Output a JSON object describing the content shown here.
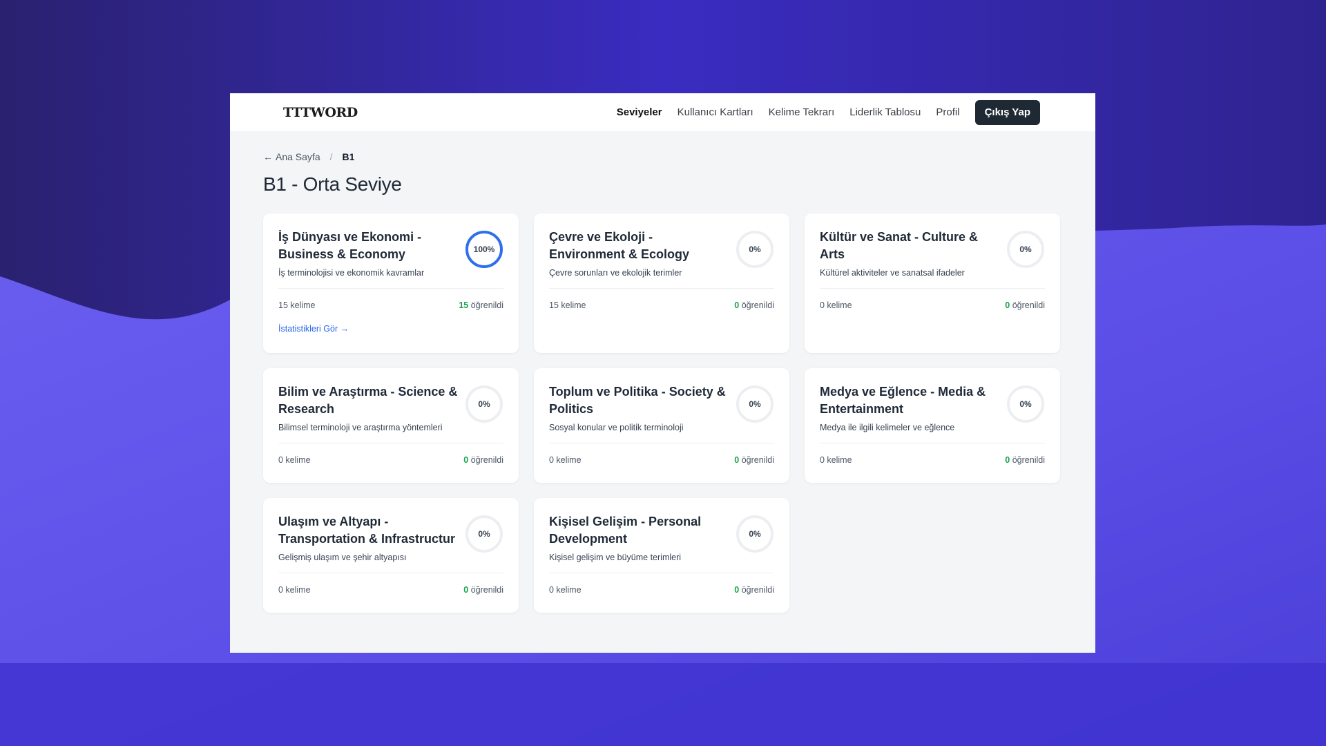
{
  "brand": {
    "logo": "TTTWORD"
  },
  "nav": {
    "items": [
      {
        "label": "Seviyeler",
        "active": true
      },
      {
        "label": "Kullanıcı Kartları",
        "active": false
      },
      {
        "label": "Kelime Tekrarı",
        "active": false
      },
      {
        "label": "Liderlik Tablosu",
        "active": false
      },
      {
        "label": "Profil",
        "active": false
      }
    ],
    "logout_label": "Çıkış Yap"
  },
  "breadcrumb": {
    "back_arrow": "←",
    "home": "Ana Sayfa",
    "separator": "/",
    "current": "B1"
  },
  "page": {
    "title": "B1 - Orta Seviye"
  },
  "colors": {
    "ring_active": "#2f6fed",
    "ring_track": "#eceef1",
    "learned": "#16a34a",
    "link": "#2563eb",
    "logout_bg": "#1f2933"
  },
  "cards": [
    {
      "title": "İş Dünyası ve Ekonomi - Business & Economy",
      "description": "İş terminolojisi ve ekonomik kavramlar",
      "progress": 100,
      "progress_label": "100%",
      "words_label": "15 kelime",
      "learned_count": "15",
      "learned_label": "öğrenildi",
      "stats_link": "İstatistikleri Gör →"
    },
    {
      "title": "Çevre ve Ekoloji - Environment & Ecology",
      "description": "Çevre sorunları ve ekolojik terimler",
      "progress": 0,
      "progress_label": "0%",
      "words_label": "15 kelime",
      "learned_count": "0",
      "learned_label": "öğrenildi"
    },
    {
      "title": "Kültür ve Sanat - Culture & Arts",
      "description": "Kültürel aktiviteler ve sanatsal ifadeler",
      "progress": 0,
      "progress_label": "0%",
      "words_label": "0 kelime",
      "learned_count": "0",
      "learned_label": "öğrenildi"
    },
    {
      "title": "Bilim ve Araştırma - Science & Research",
      "description": "Bilimsel terminoloji ve araştırma yöntemleri",
      "progress": 0,
      "progress_label": "0%",
      "words_label": "0 kelime",
      "learned_count": "0",
      "learned_label": "öğrenildi"
    },
    {
      "title": "Toplum ve Politika - Society & Politics",
      "description": "Sosyal konular ve politik terminoloji",
      "progress": 0,
      "progress_label": "0%",
      "words_label": "0 kelime",
      "learned_count": "0",
      "learned_label": "öğrenildi"
    },
    {
      "title": "Medya ve Eğlence - Media & Entertainment",
      "description": "Medya ile ilgili kelimeler ve eğlence",
      "progress": 0,
      "progress_label": "0%",
      "words_label": "0 kelime",
      "learned_count": "0",
      "learned_label": "öğrenildi"
    },
    {
      "title": "Ulaşım ve Altyapı - Transportation & Infrastructur",
      "description": "Gelişmiş ulaşım ve şehir altyapısı",
      "progress": 0,
      "progress_label": "0%",
      "words_label": "0 kelime",
      "learned_count": "0",
      "learned_label": "öğrenildi"
    },
    {
      "title": "Kişisel Gelişim - Personal Development",
      "description": "Kişisel gelişim ve büyüme terimleri",
      "progress": 0,
      "progress_label": "0%",
      "words_label": "0 kelime",
      "learned_count": "0",
      "learned_label": "öğrenildi"
    }
  ]
}
